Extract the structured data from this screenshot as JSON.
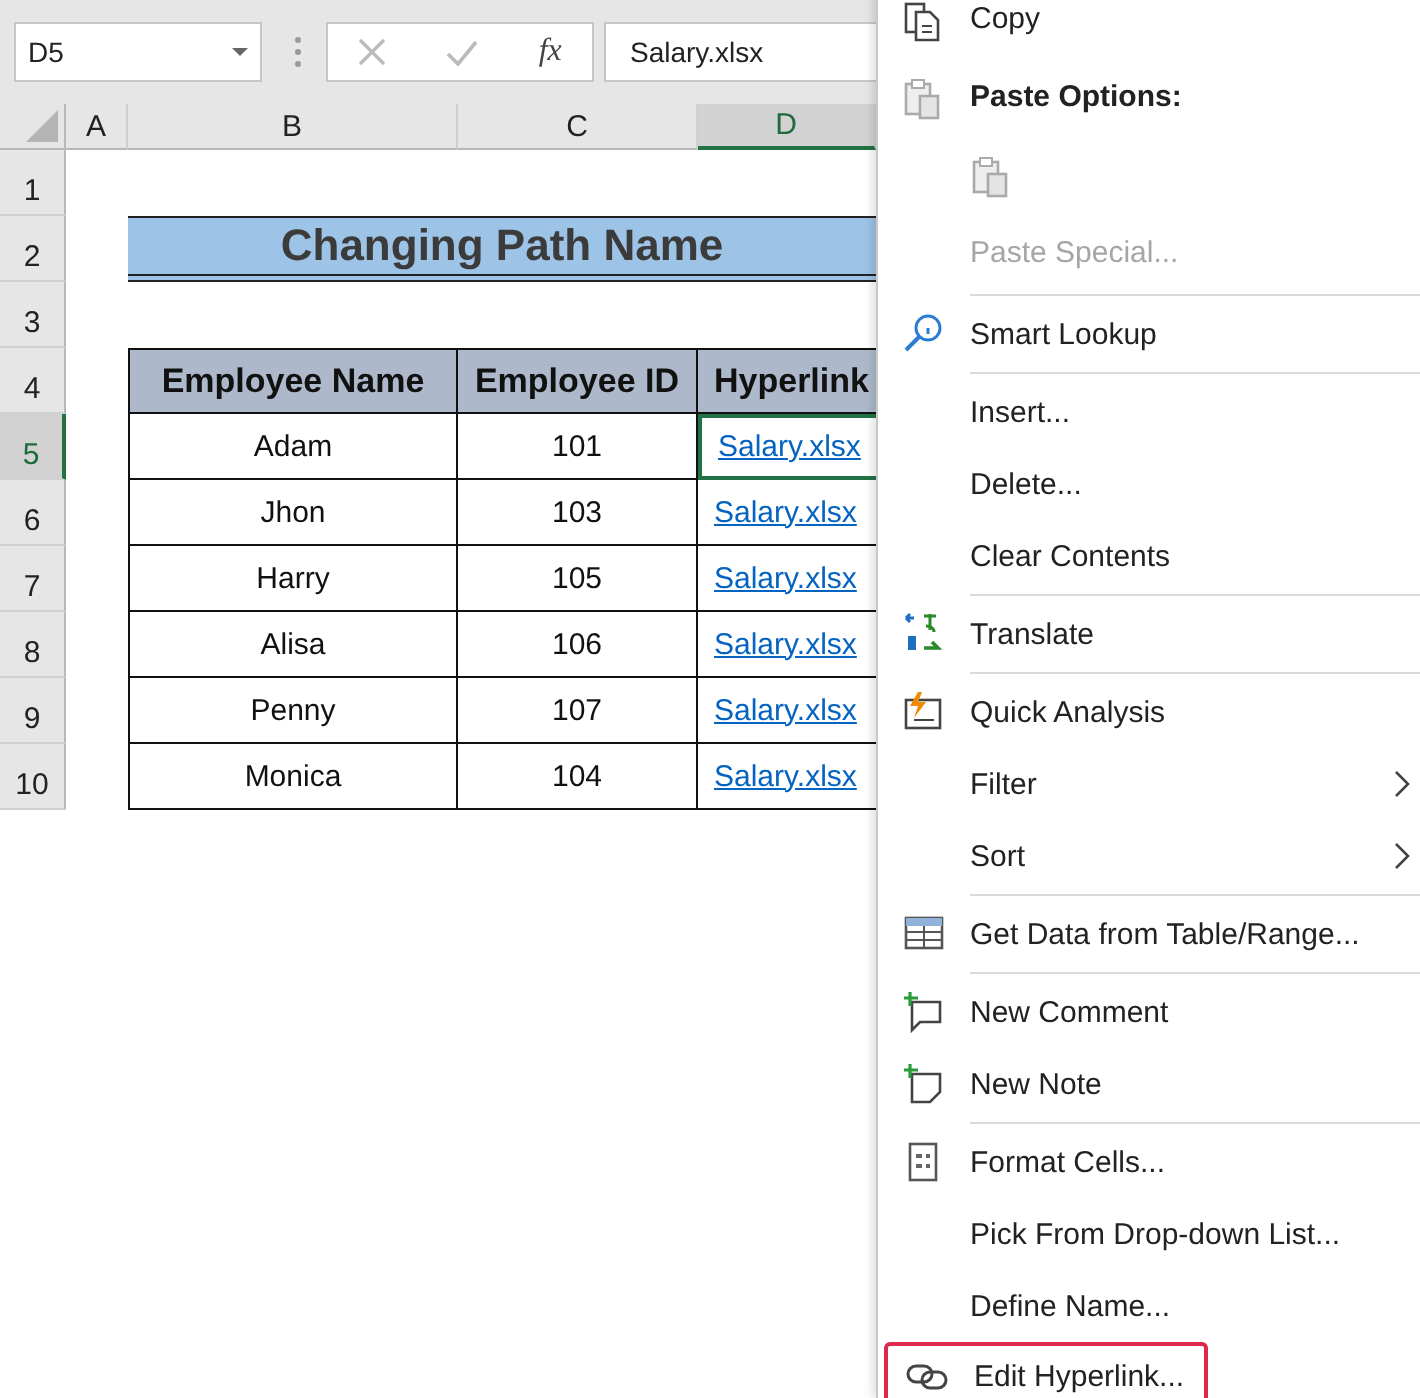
{
  "formula_bar": {
    "name_box": "D5",
    "function_label": "fx",
    "formula": "Salary.xlsx"
  },
  "sheet": {
    "columns": [
      {
        "label": "A",
        "selected": false
      },
      {
        "label": "B",
        "selected": false
      },
      {
        "label": "C",
        "selected": false
      },
      {
        "label": "D",
        "selected": true
      }
    ],
    "rows": [
      {
        "label": "1",
        "selected": false
      },
      {
        "label": "2",
        "selected": false
      },
      {
        "label": "3",
        "selected": false
      },
      {
        "label": "4",
        "selected": false
      },
      {
        "label": "5",
        "selected": true
      },
      {
        "label": "6",
        "selected": false
      },
      {
        "label": "7",
        "selected": false
      },
      {
        "label": "8",
        "selected": false
      },
      {
        "label": "9",
        "selected": false
      },
      {
        "label": "10",
        "selected": false
      }
    ],
    "title": "Changing Path Name",
    "table": {
      "columns": [
        "Employee Name",
        "Employee ID",
        "Hyperlink"
      ],
      "rows": [
        {
          "name": "Adam",
          "id": "101",
          "link": "Salary.xlsx",
          "selected": true
        },
        {
          "name": "Jhon",
          "id": "103",
          "link": "Salary.xlsx",
          "selected": false
        },
        {
          "name": "Harry",
          "id": "105",
          "link": "Salary.xlsx",
          "selected": false
        },
        {
          "name": "Alisa",
          "id": "106",
          "link": "Salary.xlsx",
          "selected": false
        },
        {
          "name": "Penny",
          "id": "107",
          "link": "Salary.xlsx",
          "selected": false
        },
        {
          "name": "Monica",
          "id": "104",
          "link": "Salary.xlsx",
          "selected": false
        }
      ]
    }
  },
  "context_menu": [
    {
      "kind": "item",
      "label": "Copy",
      "disabled": false,
      "submenu": false,
      "highlighted": false
    },
    {
      "kind": "header",
      "label": "Paste Options:"
    },
    {
      "kind": "paste"
    },
    {
      "kind": "item",
      "label": "Paste Special...",
      "disabled": true,
      "submenu": false,
      "highlighted": false
    },
    {
      "kind": "separator"
    },
    {
      "kind": "item",
      "label": "Smart Lookup",
      "disabled": false,
      "submenu": false,
      "highlighted": false
    },
    {
      "kind": "separator"
    },
    {
      "kind": "item",
      "label": "Insert...",
      "disabled": false,
      "submenu": false,
      "highlighted": false
    },
    {
      "kind": "item",
      "label": "Delete...",
      "disabled": false,
      "submenu": false,
      "highlighted": false
    },
    {
      "kind": "item",
      "label": "Clear Contents",
      "disabled": false,
      "submenu": false,
      "highlighted": false
    },
    {
      "kind": "separator"
    },
    {
      "kind": "item",
      "label": "Translate",
      "disabled": false,
      "submenu": false,
      "highlighted": false
    },
    {
      "kind": "separator"
    },
    {
      "kind": "item",
      "label": "Quick Analysis",
      "disabled": false,
      "submenu": false,
      "highlighted": false
    },
    {
      "kind": "item",
      "label": "Filter",
      "disabled": false,
      "submenu": true,
      "highlighted": false
    },
    {
      "kind": "item",
      "label": "Sort",
      "disabled": false,
      "submenu": true,
      "highlighted": false
    },
    {
      "kind": "separator"
    },
    {
      "kind": "item",
      "label": "Get Data from Table/Range...",
      "disabled": false,
      "submenu": false,
      "highlighted": false
    },
    {
      "kind": "separator"
    },
    {
      "kind": "item",
      "label": "New Comment",
      "disabled": false,
      "submenu": false,
      "highlighted": false
    },
    {
      "kind": "item",
      "label": "New Note",
      "disabled": false,
      "submenu": false,
      "highlighted": false
    },
    {
      "kind": "separator"
    },
    {
      "kind": "item",
      "label": "Format Cells...",
      "disabled": false,
      "submenu": false,
      "highlighted": false
    },
    {
      "kind": "item",
      "label": "Pick From Drop-down List...",
      "disabled": false,
      "submenu": false,
      "highlighted": false
    },
    {
      "kind": "item",
      "label": "Define Name...",
      "disabled": false,
      "submenu": false,
      "highlighted": false
    },
    {
      "kind": "item",
      "label": "Edit Hyperlink...",
      "disabled": false,
      "submenu": false,
      "highlighted": true
    }
  ]
}
